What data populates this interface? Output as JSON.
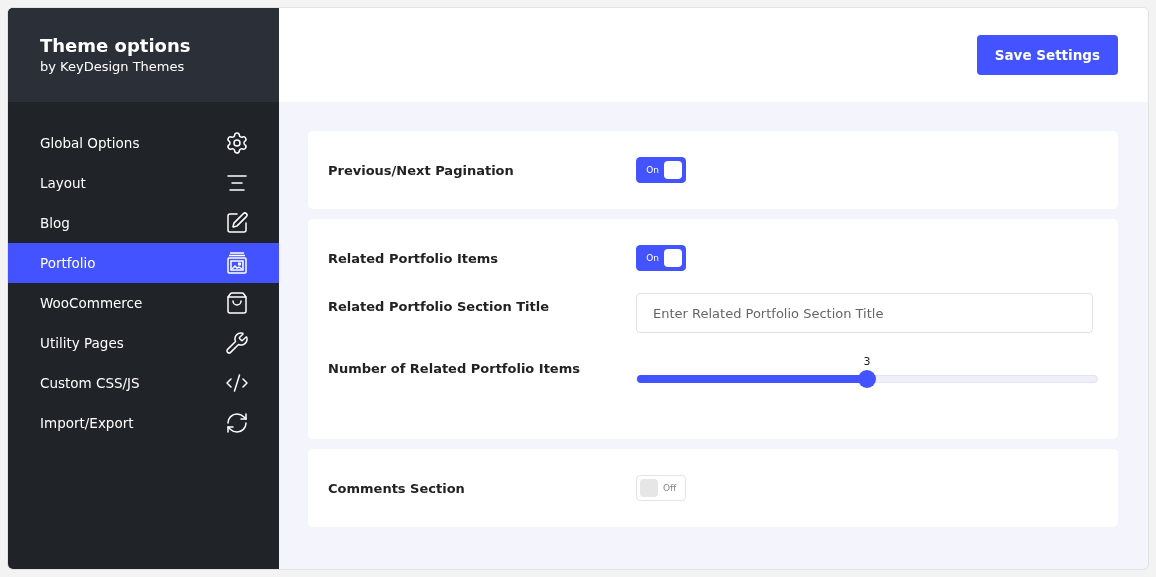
{
  "sidebar": {
    "title": "Theme options",
    "subtitle": "by KeyDesign Themes",
    "items": [
      {
        "label": "Global Options",
        "selected": false
      },
      {
        "label": "Layout",
        "selected": false
      },
      {
        "label": "Blog",
        "selected": false
      },
      {
        "label": "Portfolio",
        "selected": true
      },
      {
        "label": "WooCommerce",
        "selected": false
      },
      {
        "label": "Utility Pages",
        "selected": false
      },
      {
        "label": "Custom CSS/JS",
        "selected": false
      },
      {
        "label": "Import/Export",
        "selected": false
      }
    ]
  },
  "save_button": "Save Settings",
  "cards": [
    {
      "rows": [
        {
          "kind": "toggle",
          "label": "Previous/Next Pagination",
          "on": true,
          "state_label": "On"
        }
      ]
    },
    {
      "rows": [
        {
          "kind": "toggle",
          "label": "Related Portfolio Items",
          "on": true,
          "state_label": "On"
        },
        {
          "kind": "text",
          "label": "Related Portfolio Section Title",
          "placeholder": "Enter Related Portfolio Section Title"
        },
        {
          "kind": "slider",
          "label": "Number of Related Portfolio Items",
          "reading": "3",
          "level": 0.5
        }
      ]
    },
    {
      "rows": [
        {
          "kind": "toggle",
          "label": "Comments Section",
          "on": false,
          "state_label": "Off"
        }
      ]
    }
  ]
}
